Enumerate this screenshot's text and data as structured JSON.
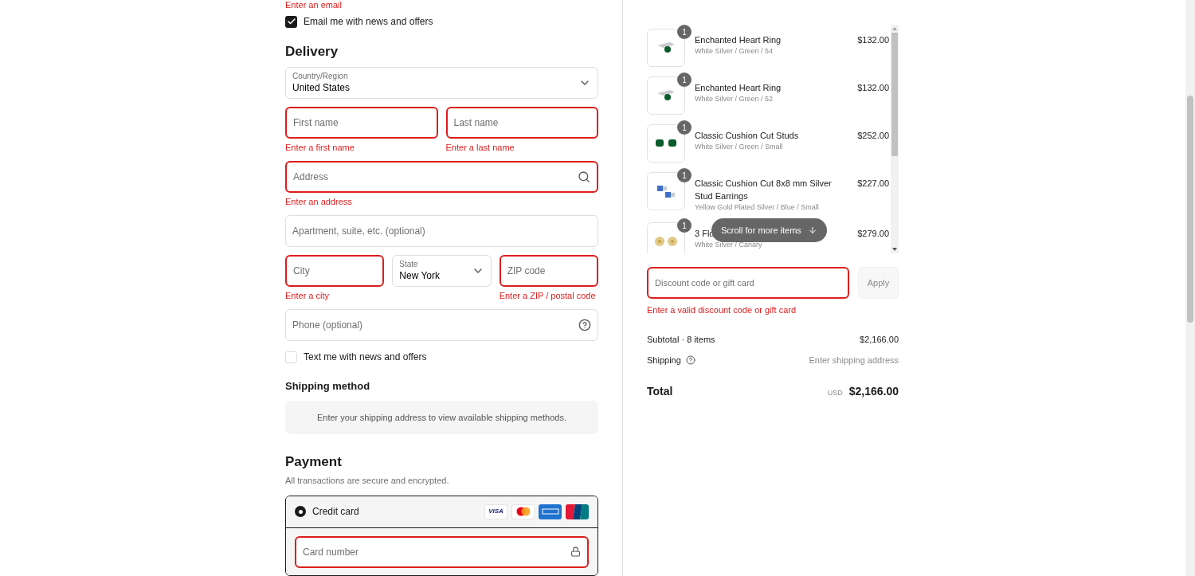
{
  "contact": {
    "error": "Enter an email",
    "newsletter": {
      "label": "Email me with news and offers",
      "checked": true
    }
  },
  "delivery": {
    "title": "Delivery",
    "rows": [
      [
        {
          "kind": "select",
          "label": "Country/Region",
          "value": "United States",
          "error": false
        }
      ],
      [
        {
          "kind": "text",
          "placeholder": "First name",
          "error": true,
          "message": "Enter a first name"
        },
        {
          "kind": "text",
          "placeholder": "Last name",
          "error": true,
          "message": "Enter a last name"
        }
      ],
      [
        {
          "kind": "search",
          "placeholder": "Address",
          "error": true,
          "message": "Enter an address"
        }
      ],
      [
        {
          "kind": "text",
          "placeholder": "Apartment, suite, etc. (optional)",
          "error": false
        }
      ],
      [
        {
          "kind": "text",
          "placeholder": "City",
          "error": true,
          "message": "Enter a city"
        },
        {
          "kind": "select",
          "label": "State",
          "value": "New York",
          "error": false
        },
        {
          "kind": "text",
          "placeholder": "ZIP code",
          "error": true,
          "message": "Enter a ZIP / postal code"
        }
      ],
      [
        {
          "kind": "help",
          "placeholder": "Phone (optional)",
          "error": false
        }
      ]
    ],
    "sms": {
      "label": "Text me with news and offers",
      "checked": false
    }
  },
  "shipping_method": {
    "title": "Shipping method",
    "notice": "Enter your shipping address to view available shipping methods."
  },
  "payment": {
    "title": "Payment",
    "subtitle": "All transactions are secure and encrypted.",
    "methods": [
      {
        "label": "Credit card",
        "selected": true,
        "cards": [
          {
            "kind": "visa",
            "label": "VISA"
          },
          {
            "kind": "mastercard"
          },
          {
            "kind": "amex"
          },
          {
            "kind": "unionpay"
          }
        ]
      }
    ],
    "card_number": {
      "placeholder": "Card number",
      "error": true
    }
  },
  "cart": {
    "items": [
      {
        "quantity": "1",
        "name": "Enchanted Heart Ring",
        "variant": "White Silver / Green / 54",
        "price": "$132.00",
        "kind": "ring"
      },
      {
        "quantity": "1",
        "name": "Enchanted Heart Ring",
        "variant": "White Silver / Green / 52",
        "price": "$132.00",
        "kind": "ring"
      },
      {
        "quantity": "1",
        "name": "Classic Cushion Cut Studs",
        "variant": "White Silver / Green / Small",
        "price": "$252.00",
        "kind": "green-studs"
      },
      {
        "quantity": "1",
        "name": "Classic Cushion Cut 8x8 mm Silver Stud Earrings",
        "variant": "Yellow Gold Plated Silver / Blue / Small",
        "price": "$227.00",
        "kind": "blue-studs"
      },
      {
        "quantity": "1",
        "name": "3 Flo",
        "variant": "White Silver / Canary",
        "price": "$279.00",
        "kind": "flowers"
      }
    ],
    "scroll_hint": "Scroll for more items"
  },
  "discount": {
    "placeholder": "Discount code or gift card",
    "error": true,
    "message": "Enter a valid discount code or gift card",
    "button": "Apply"
  },
  "summary": {
    "subtotal_label": "Subtotal · 8 items",
    "subtotal": "$2,166.00",
    "shipping_label": "Shipping",
    "shipping": "Enter shipping address",
    "total_label": "Total",
    "currency": "USD",
    "total": "$2,166.00"
  }
}
